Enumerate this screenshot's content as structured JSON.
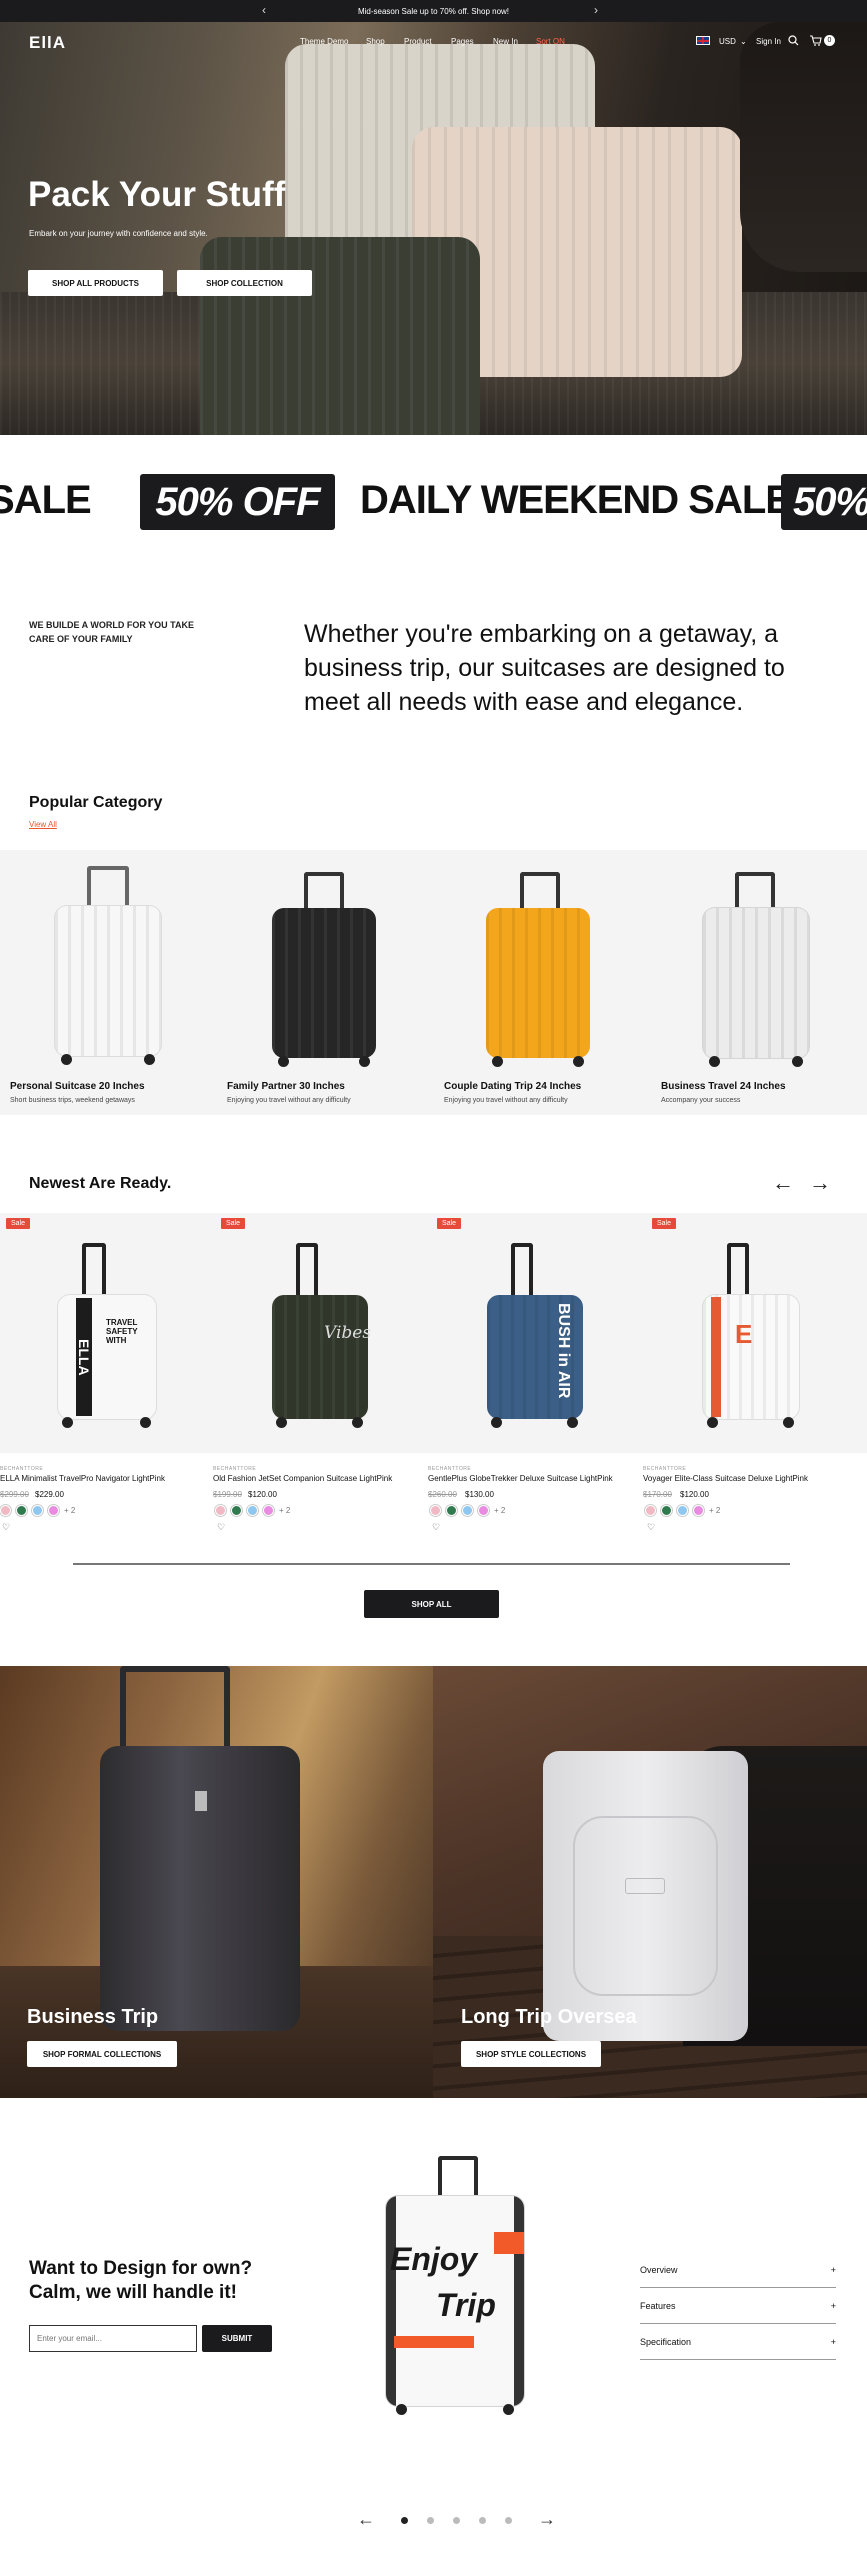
{
  "announcement": {
    "text": "Mid-season Sale up to 70% off. Shop now!"
  },
  "header": {
    "logo": "EllA",
    "menu": [
      "Theme Demo",
      "Shop",
      "Product",
      "Pages",
      "New In",
      "Sort ON"
    ],
    "currency": "USD",
    "sign_in": "Sign In",
    "cart_count": "0"
  },
  "hero": {
    "title": "Pack Your Stuff",
    "subtitle": "Embark on your journey with confidence and style.",
    "btn_products": "SHOP ALL PRODUCTS",
    "btn_collection": "SHOP COLLECTION"
  },
  "marquee": {
    "text_left": "SALE",
    "box_1": "50% OFF",
    "text_mid": "DAILY WEEKEND SALE",
    "box_2": "50%"
  },
  "about": {
    "tagline": "WE BUILDE A WORLD FOR YOU TAKE CARE OF YOUR FAMILY",
    "statement": "Whether you're embarking on a getaway, a business trip, our suitcases are designed to meet all needs with ease and elegance."
  },
  "popular": {
    "title": "Popular Category",
    "view_all": "View All",
    "items": [
      {
        "name": "Personal Suitcase 20 Inches",
        "desc": "Short business trips, weekend getaways",
        "color": "#f2f2f2"
      },
      {
        "name": "Family Partner 30 Inches",
        "desc": "Enjoying you travel without any difficulty",
        "color": "#2a2a2a"
      },
      {
        "name": "Couple Dating Trip 24 Inches",
        "desc": "Enjoying you travel without any difficulty",
        "color": "#f2a31b"
      },
      {
        "name": "Business Travel 24 Inches",
        "desc": "Accompany your success",
        "color": "#e8e8e8"
      }
    ]
  },
  "newest": {
    "title": "Newest Are Ready.",
    "sale_label": "Sale",
    "vendor": "BECHANTTORE",
    "more_colors": "+ 2",
    "products": [
      {
        "name": "ELLA Minimalist TravelPro Navigator LightPink",
        "old": "$299.00",
        "price": "$229.00",
        "art": "ELLA",
        "color": "#f5f5f5"
      },
      {
        "name": "Old Fashion JetSet Companion Suitcase LightPink",
        "old": "$199.00",
        "price": "$120.00",
        "art": "Vibes",
        "color": "#333a2a"
      },
      {
        "name": "GentlePlus GlobeTrekker Deluxe Suitcase LightPink",
        "old": "$260.00",
        "price": "$130.00",
        "art": "BUSH in AIR",
        "color": "#3b5f86"
      },
      {
        "name": "Voyager Elite-Class Suitcase Deluxe LightPink",
        "old": "$170.00",
        "price": "$120.00",
        "art": "E",
        "color": "#f7f7f7"
      }
    ],
    "swatches": [
      "#f0b9c4",
      "#2f7a4e",
      "#8ec7ef",
      "#e98be0"
    ],
    "shop_all": "SHOP ALL"
  },
  "banners": [
    {
      "title": "Business Trip",
      "button": "SHOP FORMAL COLLECTIONS"
    },
    {
      "title": "Long Trip Oversea",
      "button": "SHOP STYLE COLLECTIONS"
    }
  ],
  "design": {
    "title": "Want to Design for own? Calm, we will handle it!",
    "email_placeholder": "Enter your email...",
    "submit": "SUBMIT",
    "art_line1": "Enjoy",
    "art_line2": "Trip",
    "accordion": [
      "Overview",
      "Features",
      "Specification"
    ]
  }
}
